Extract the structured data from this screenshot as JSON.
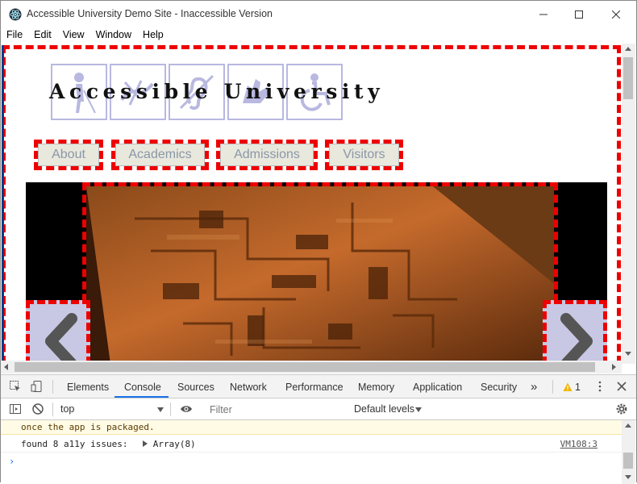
{
  "window": {
    "title": "Accessible University Demo Site - Inaccessible Version",
    "controls": {
      "minimize": "—",
      "maximize": "☐",
      "close": "✕"
    }
  },
  "menu": [
    "File",
    "Edit",
    "View",
    "Window",
    "Help"
  ],
  "site": {
    "logo_text": "Accessible University",
    "nav": [
      "About",
      "Academics",
      "Admissions",
      "Visitors"
    ]
  },
  "devtools": {
    "tabs": [
      "Elements",
      "Console",
      "Sources",
      "Network",
      "Performance",
      "Memory",
      "Application",
      "Security"
    ],
    "active_tab": "Console",
    "more_tabs": "»",
    "warning_count": "1",
    "context": "top",
    "filter_placeholder": "Filter",
    "levels": "Default levels",
    "console": {
      "warning_text": "once the app is packaged.",
      "log_text": "found 8 a11y issues:",
      "log_value": "Array(8)",
      "log_source": "VM108:3",
      "prompt": "›"
    }
  },
  "colors": {
    "outline": "#e00000",
    "accent": "#1a73e8",
    "logo_icons": "#b8b8e0"
  }
}
